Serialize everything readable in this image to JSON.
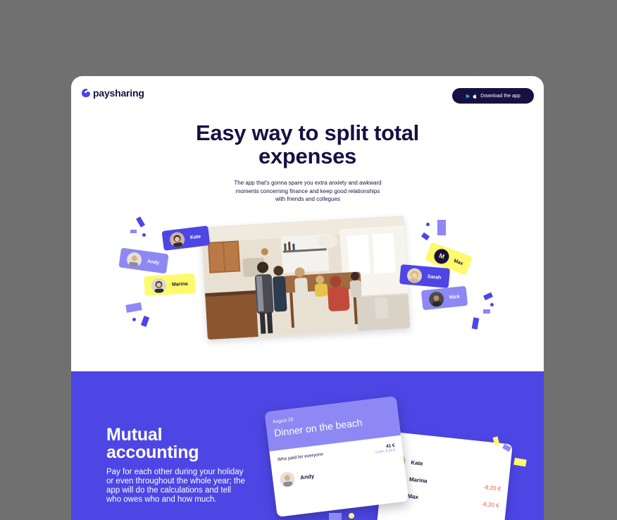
{
  "header": {
    "brand": "paysharing",
    "download_label": "Download the app"
  },
  "hero": {
    "title_line1": "Easy way to split total",
    "title_line2": "expenses",
    "subtitle_line1": "The app that's gonna spare you extra anxiety and awkward",
    "subtitle_line2": "moments concerning finance and keep good relationships",
    "subtitle_line3": "with friends and collegues"
  },
  "tags": {
    "kate": "Kate",
    "andy": "Andy",
    "marina": "Marina",
    "max": "Max",
    "max_initial": "M",
    "sarah": "Sarah",
    "nick": "Nick"
  },
  "mutual": {
    "title_line1": "Mutual",
    "title_line2": "accounting",
    "text": "Pay for each other during your holiday or even throughout the whole year; the app will do the calculations and tell who owes who and how much."
  },
  "expense_card": {
    "date": "August 28",
    "title": "Dinner on the beach",
    "paid_label": "Who paid for everyone",
    "total": "41 €",
    "per_person": "1 pax: 8,20 €",
    "payer": "Andy"
  },
  "debts_card": {
    "header_fragment": "e",
    "rows": [
      {
        "name": "Kate",
        "amount": ""
      },
      {
        "name": "Marina",
        "amount": "-8,20 €"
      },
      {
        "name": "Max",
        "amount": "-8,20 €"
      }
    ],
    "max_initial": "M"
  },
  "colors": {
    "navy": "#161141",
    "blue": "#4d46e5",
    "violet": "#8d88f3",
    "yellow": "#fff96d"
  }
}
